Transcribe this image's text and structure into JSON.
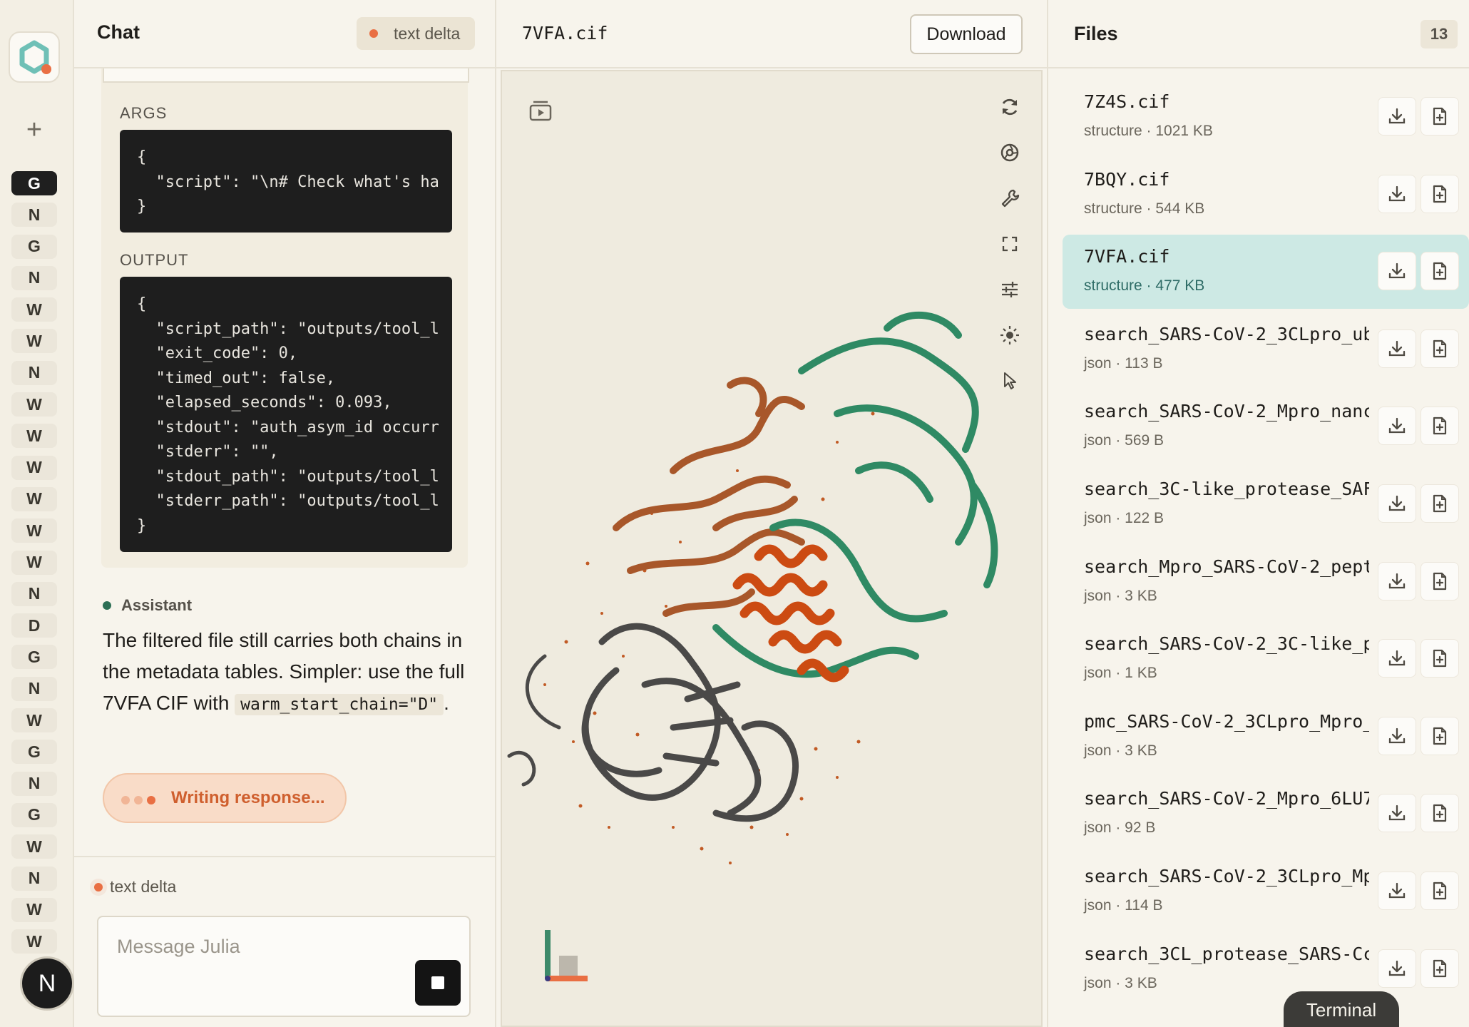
{
  "rail": {
    "items": [
      "G",
      "N",
      "G",
      "N",
      "W",
      "W",
      "N",
      "W",
      "W",
      "W",
      "W",
      "W",
      "W",
      "N",
      "D",
      "G",
      "N",
      "W",
      "G",
      "N",
      "G",
      "W",
      "N",
      "W",
      "W"
    ],
    "avatar_letter": "N"
  },
  "chat": {
    "title": "Chat",
    "status_badge": "text delta",
    "args_label": "ARGS",
    "args_code": "{\n  \"script\": \"\\n# Check what's ha\n}",
    "output_label": "OUTPUT",
    "output_code": "{\n  \"script_path\": \"outputs/tool_l\n  \"exit_code\": 0,\n  \"timed_out\": false,\n  \"elapsed_seconds\": 0.093,\n  \"stdout\": \"auth_asym_id occurr\n  \"stderr\": \"\",\n  \"stdout_path\": \"outputs/tool_l\n  \"stderr_path\": \"outputs/tool_l\n}",
    "assistant_label": "Assistant",
    "assistant_text": "The filtered file still carries both chains in the metadata tables. Simpler: use the full 7VFA CIF with ",
    "assistant_code": "warm_start_chain=\"D\"",
    "assistant_suffix": ".",
    "writing_label": "Writing response...",
    "composer_status": "text delta",
    "composer_placeholder": "Message Julia"
  },
  "viewer": {
    "title": "7VFA.cif",
    "download_label": "Download"
  },
  "files": {
    "title": "Files",
    "count": "13",
    "items": [
      {
        "name": "7Z4S.cif",
        "meta": "structure · 1021 KB"
      },
      {
        "name": "7BQY.cif",
        "meta": "structure · 544 KB"
      },
      {
        "name": "7VFA.cif",
        "meta": "structure · 477 KB"
      },
      {
        "name": "search_SARS-CoV-2_3CLpro_ub",
        "meta": "json · 113 B"
      },
      {
        "name": "search_SARS-CoV-2_Mpro_nanc",
        "meta": "json · 569 B"
      },
      {
        "name": "search_3C-like_protease_SAF",
        "meta": "json · 122 B"
      },
      {
        "name": "search_Mpro_SARS-CoV-2_pept",
        "meta": "json · 3 KB"
      },
      {
        "name": "search_SARS-CoV-2_3C-like_p",
        "meta": "json · 1 KB"
      },
      {
        "name": "pmc_SARS-CoV-2_3CLpro_Mpro_",
        "meta": "json · 3 KB"
      },
      {
        "name": "search_SARS-CoV-2_Mpro_6LU7",
        "meta": "json · 92 B"
      },
      {
        "name": "search_SARS-CoV-2_3CLpro_Mp",
        "meta": "json · 114 B"
      },
      {
        "name": "search_3CL_protease_SARS-Cc",
        "meta": "json · 3 KB"
      }
    ],
    "terminal_label": "Terminal"
  },
  "colors": {
    "accent_orange": "#e96f43",
    "selected_row": "#cde9e4",
    "chain_green": "#2f8a64",
    "chain_brown": "#a8572a",
    "chain_red": "#cc4b12",
    "chain_gray": "#4a4948"
  }
}
